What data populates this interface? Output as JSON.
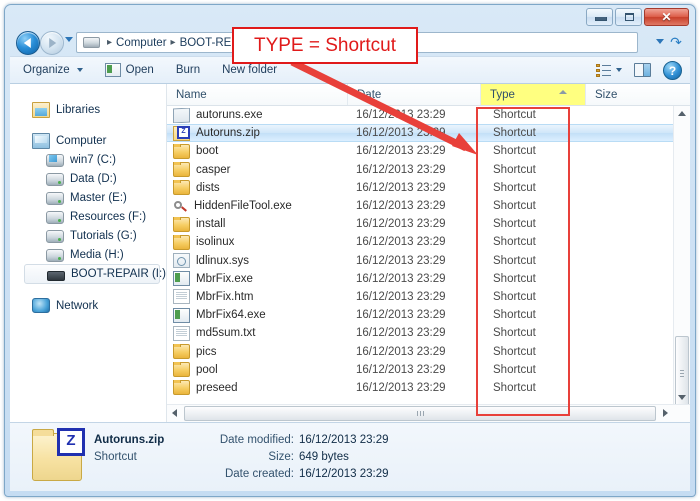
{
  "window": {
    "controls": {
      "minimize": "–",
      "maximize": "□",
      "close": "✕"
    }
  },
  "address": {
    "breadcrumbs": [
      "Computer",
      "BOOT-REPA"
    ],
    "separator": "▸",
    "refresh_icon": "refresh-icon"
  },
  "toolbar": {
    "organize": "Organize",
    "open": "Open",
    "burn": "Burn",
    "new_folder": "New folder",
    "help_label": "?"
  },
  "sidebar": {
    "items": [
      {
        "label": "Libraries",
        "icon": "library-icon",
        "indent": false,
        "selected": false
      },
      {
        "label": "Computer",
        "icon": "computer-icon",
        "indent": false,
        "selected": false
      },
      {
        "label": "win7 (C:)",
        "icon": "windows-drive-icon",
        "indent": true,
        "selected": false
      },
      {
        "label": "Data (D:)",
        "icon": "hard-drive-icon",
        "indent": true,
        "selected": false
      },
      {
        "label": "Master (E:)",
        "icon": "hard-drive-icon",
        "indent": true,
        "selected": false
      },
      {
        "label": "Resources (F:)",
        "icon": "hard-drive-icon",
        "indent": true,
        "selected": false
      },
      {
        "label": "Tutorials (G:)",
        "icon": "hard-drive-icon",
        "indent": true,
        "selected": false
      },
      {
        "label": "Media (H:)",
        "icon": "hard-drive-icon",
        "indent": true,
        "selected": false
      },
      {
        "label": "BOOT-REPAIR (I:)",
        "icon": "usb-drive-icon",
        "indent": true,
        "selected": true
      },
      {
        "label": "Network",
        "icon": "network-icon",
        "indent": false,
        "selected": false
      }
    ]
  },
  "columns": [
    {
      "key": "name",
      "label": "Name",
      "sorted": false,
      "highlighted": false
    },
    {
      "key": "date",
      "label": "Date",
      "sorted": false,
      "highlighted": false
    },
    {
      "key": "type",
      "label": "Type",
      "sorted": true,
      "highlighted": true
    },
    {
      "key": "size",
      "label": "Size",
      "sorted": false,
      "highlighted": false
    }
  ],
  "files": [
    {
      "name": "autoruns.exe",
      "date": "16/12/2013 23:29",
      "type": "Shortcut",
      "size": "",
      "icon": "application-icon",
      "selected": false
    },
    {
      "name": "Autoruns.zip",
      "date": "16/12/2013 23:29",
      "type": "Shortcut",
      "size": "",
      "icon": "zip-icon",
      "selected": true
    },
    {
      "name": "boot",
      "date": "16/12/2013 23:29",
      "type": "Shortcut",
      "size": "",
      "icon": "folder-icon",
      "selected": false
    },
    {
      "name": "casper",
      "date": "16/12/2013 23:29",
      "type": "Shortcut",
      "size": "",
      "icon": "folder-icon",
      "selected": false
    },
    {
      "name": "dists",
      "date": "16/12/2013 23:29",
      "type": "Shortcut",
      "size": "",
      "icon": "folder-icon",
      "selected": false
    },
    {
      "name": "HiddenFileTool.exe",
      "date": "16/12/2013 23:29",
      "type": "Shortcut",
      "size": "",
      "icon": "magnifier-icon",
      "selected": false
    },
    {
      "name": "install",
      "date": "16/12/2013 23:29",
      "type": "Shortcut",
      "size": "",
      "icon": "folder-icon",
      "selected": false
    },
    {
      "name": "isolinux",
      "date": "16/12/2013 23:29",
      "type": "Shortcut",
      "size": "",
      "icon": "folder-icon",
      "selected": false
    },
    {
      "name": "ldlinux.sys",
      "date": "16/12/2013 23:29",
      "type": "Shortcut",
      "size": "",
      "icon": "system-file-icon",
      "selected": false
    },
    {
      "name": "MbrFix.exe",
      "date": "16/12/2013 23:29",
      "type": "Shortcut",
      "size": "",
      "icon": "executable-icon",
      "selected": false
    },
    {
      "name": "MbrFix.htm",
      "date": "16/12/2013 23:29",
      "type": "Shortcut",
      "size": "",
      "icon": "document-icon",
      "selected": false
    },
    {
      "name": "MbrFix64.exe",
      "date": "16/12/2013 23:29",
      "type": "Shortcut",
      "size": "",
      "icon": "executable-icon",
      "selected": false
    },
    {
      "name": "md5sum.txt",
      "date": "16/12/2013 23:29",
      "type": "Shortcut",
      "size": "",
      "icon": "text-file-icon",
      "selected": false
    },
    {
      "name": "pics",
      "date": "16/12/2013 23:29",
      "type": "Shortcut",
      "size": "",
      "icon": "folder-icon",
      "selected": false
    },
    {
      "name": "pool",
      "date": "16/12/2013 23:29",
      "type": "Shortcut",
      "size": "",
      "icon": "folder-icon",
      "selected": false
    },
    {
      "name": "preseed",
      "date": "16/12/2013 23:29",
      "type": "Shortcut",
      "size": "",
      "icon": "folder-icon",
      "selected": false
    }
  ],
  "details": {
    "file_name": "Autoruns.zip",
    "file_type": "Shortcut",
    "date_modified_label": "Date modified:",
    "date_modified_value": "16/12/2013 23:29",
    "size_label": "Size:",
    "size_value": "649 bytes",
    "date_created_label": "Date created:",
    "date_created_value": "16/12/2013 23:29"
  },
  "annotation": {
    "callout_text": "TYPE = Shortcut",
    "accent_color": "#e01a1a",
    "box_color": "#e8403a",
    "highlight_color": "#ffff80"
  }
}
